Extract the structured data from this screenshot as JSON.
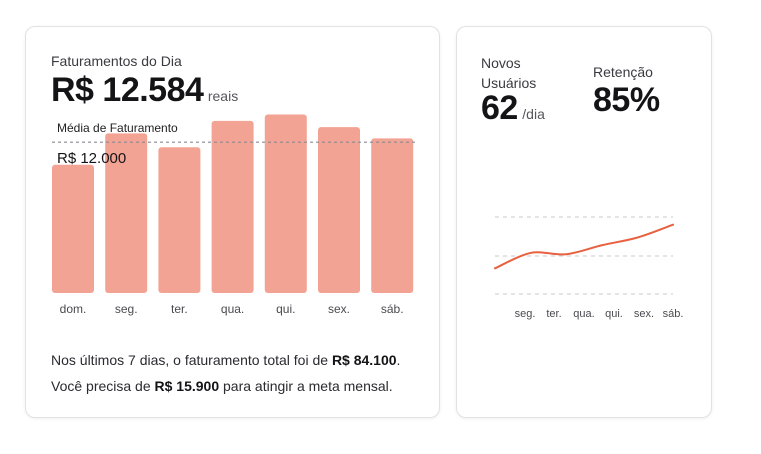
{
  "revenue_card": {
    "title": "Faturamentos do Dia",
    "value": "R$ 12.584",
    "unit": "reais",
    "average_label": "Média de Faturamento",
    "average_value": "R$ 12.000",
    "summary_line1_prefix": "Nos últimos 7 dias, o faturamento total foi de ",
    "summary_line1_value": "R$ 84.100",
    "summary_line1_suffix": ".",
    "summary_line2_prefix": "Você precisa de ",
    "summary_line2_value": "R$ 15.900",
    "summary_line2_suffix": " para atingir a meta mensal."
  },
  "users_card": {
    "new_users_label": "Novos Usuários",
    "new_users_value": "62",
    "new_users_unit": "/dia",
    "retention_label": "Retenção",
    "retention_value": "85%"
  },
  "colors": {
    "bar": "#f3a393",
    "line": "#e8603f",
    "gridline": "#c9c9cf"
  },
  "chart_data": [
    {
      "type": "bar",
      "categories": [
        "dom.",
        "seg.",
        "ter.",
        "qua.",
        "qui.",
        "sex.",
        "sáb."
      ],
      "values": [
        10200,
        12700,
        11600,
        13700,
        14200,
        13200,
        12300
      ],
      "reference_line": 12000,
      "ylim": [
        0,
        14800
      ]
    },
    {
      "type": "line",
      "categories": [
        "seg.",
        "ter.",
        "qua.",
        "qui.",
        "sex.",
        "sáb."
      ],
      "values": [
        1.0,
        1.6,
        1.55,
        1.9,
        2.2,
        2.7
      ],
      "ylim": [
        0,
        3
      ],
      "gridlines": 3
    }
  ]
}
